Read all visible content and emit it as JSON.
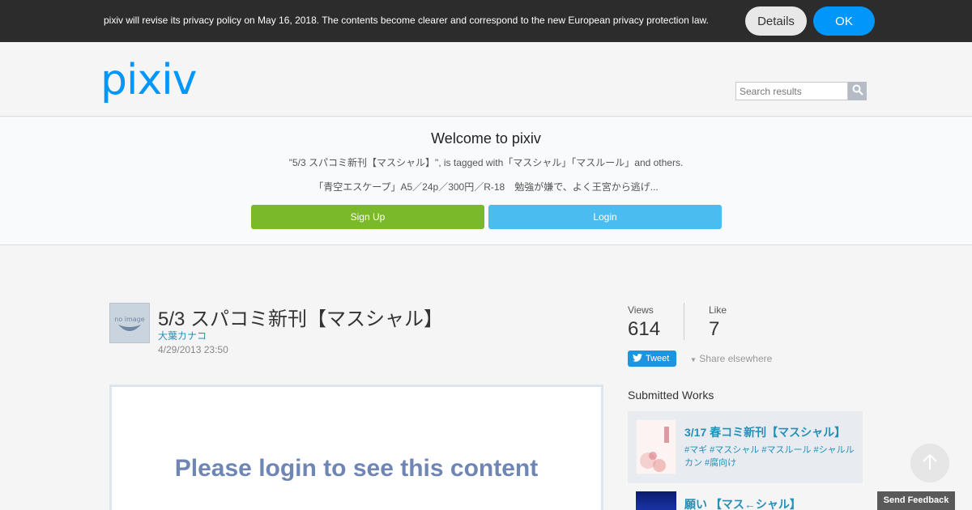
{
  "notice": {
    "text": "pixiv will revise its privacy policy on May 16, 2018. The contents become clearer and correspond to the new European privacy protection law.",
    "details_label": "Details",
    "ok_label": "OK"
  },
  "header": {
    "logo_text": "pixiv",
    "search_placeholder": "Search results"
  },
  "welcome": {
    "title": "Welcome to pixiv",
    "description": "\"5/3 スパコミ新刊【マスシャル】\", is tagged with「マスシャル」「マスルール」and others.",
    "excerpt": "「青空エスケープ」A5／24p／300円／R-18　勉強が嫌で、よく王宮から逃げ...",
    "signup_label": "Sign Up",
    "login_label": "Login"
  },
  "work": {
    "avatar_text": "no image",
    "title": "5/3 スパコミ新刊【マスシャル】",
    "author": "大葉カナコ",
    "date": "4/29/2013 23:50",
    "login_message": "Please login to see this content"
  },
  "stats": {
    "views_label": "Views",
    "views_value": "614",
    "like_label": "Like",
    "like_value": "7",
    "tweet_label": "Tweet",
    "share_label": "Share elsewhere"
  },
  "submitted": {
    "title": "Submitted Works",
    "items": [
      {
        "title": "3/17 春コミ新刊【マスシャル】",
        "tags": "#マギ #マスシャル #マスルール #シャルルカン #腐向け"
      },
      {
        "title": "願い 【マス←シャル】",
        "tags": ""
      }
    ]
  },
  "footer": {
    "feedback_label": "Send Feedback"
  },
  "colors": {
    "notice_bg": "#2c2c2c",
    "ok_blue": "#0096fa",
    "logo_blue": "#0096fa",
    "signup_green": "#7ab92a",
    "login_blue": "#4bbcf0",
    "link_blue": "#258fb8"
  }
}
